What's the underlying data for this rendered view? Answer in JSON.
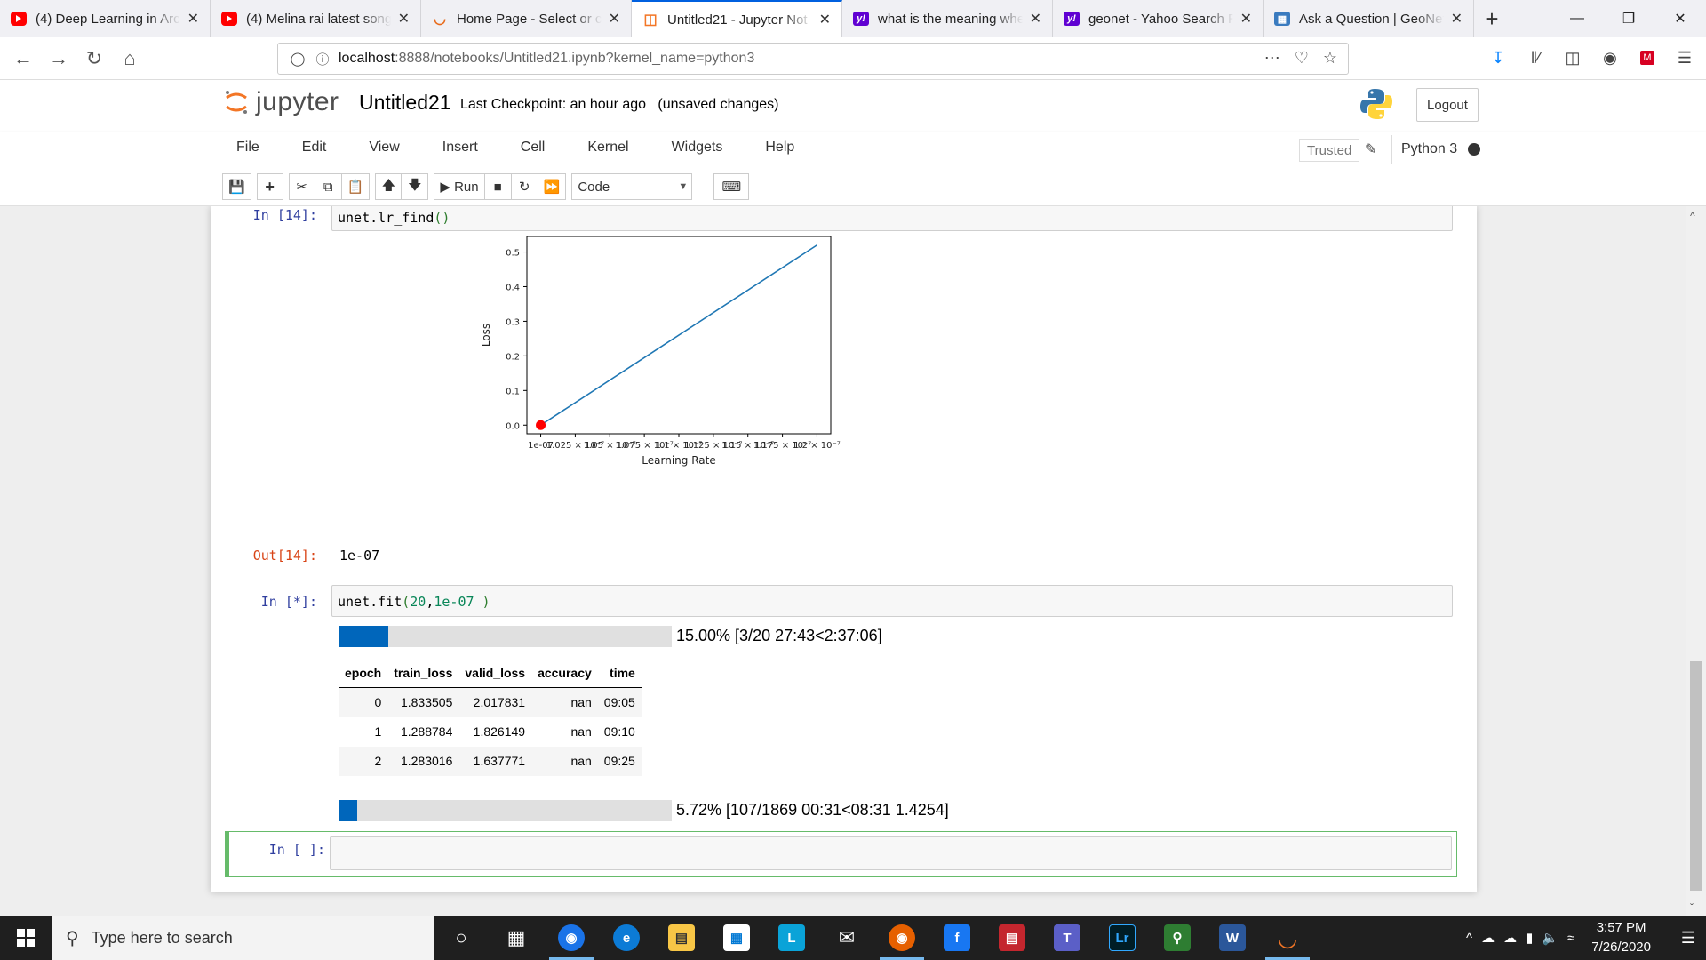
{
  "browser": {
    "tabs": [
      {
        "title": "(4) Deep Learning in Arc",
        "favicon": "youtube-icon",
        "active": false
      },
      {
        "title": "(4) Melina rai latest song",
        "favicon": "youtube-icon",
        "active": false
      },
      {
        "title": "Home Page - Select or c",
        "favicon": "upwork-icon",
        "active": false
      },
      {
        "title": "Untitled21 - Jupyter Not",
        "favicon": "jupyter-icon",
        "active": true
      },
      {
        "title": "what is the meaning whe",
        "favicon": "yahoo-icon",
        "active": false
      },
      {
        "title": "geonet - Yahoo Search R",
        "favicon": "yahoo-icon",
        "active": false
      },
      {
        "title": "Ask a Question | GeoNet",
        "favicon": "geonet-icon",
        "active": false
      }
    ],
    "url_host": "localhost",
    "url_path": ":8888/notebooks/Untitled21.ipynb?kernel_name=python3"
  },
  "jupyter": {
    "logo_text": "jupyter",
    "notebook_title": "Untitled21",
    "checkpoint": "Last Checkpoint: an hour ago",
    "unsaved": "(unsaved changes)",
    "logout": "Logout",
    "menu": [
      "File",
      "Edit",
      "View",
      "Insert",
      "Cell",
      "Kernel",
      "Widgets",
      "Help"
    ],
    "trusted": "Trusted",
    "kernel": "Python 3",
    "run_label": "Run",
    "cell_type": "Code"
  },
  "cells": {
    "c1_prompt": "In [14]:",
    "c1_obj": "unet",
    "c1_fn": ".lr_find",
    "c1_paren": "()",
    "out_prompt": "Out[14]:",
    "out_value": "1e-07",
    "c2_prompt": "In [*]:",
    "c2_obj": "unet",
    "c2_fn": ".fit",
    "c2_open": "(",
    "c2_arg1": "20",
    "c2_comma": ",",
    "c2_arg2": "1e-07",
    "c2_close": " )",
    "progress1": {
      "fraction": 0.15,
      "text": "15.00% [3/20 27:43<2:37:06]"
    },
    "progress2": {
      "fraction": 0.0572,
      "text": "5.72% [107/1869 00:31<08:31 1.4254]"
    },
    "table": {
      "headers": [
        "epoch",
        "train_loss",
        "valid_loss",
        "accuracy",
        "time"
      ],
      "rows": [
        [
          "0",
          "1.833505",
          "2.017831",
          "nan",
          "09:05"
        ],
        [
          "1",
          "1.288784",
          "1.826149",
          "nan",
          "09:10"
        ],
        [
          "2",
          "1.283016",
          "1.637771",
          "nan",
          "09:25"
        ]
      ]
    },
    "c3_prompt": "In [ ]:"
  },
  "chart_data": {
    "type": "line",
    "xlabel": "Learning Rate",
    "ylabel": "Loss",
    "x_tick_labels": [
      "1e-07",
      "1.025 × 10⁻⁷",
      "1.05 × 10⁻⁷",
      "1.075 × 10⁻⁷",
      "1.1 × 10⁻⁷",
      "1.125 × 10⁻⁷",
      "1.15 × 10⁻⁷",
      "1.175 × 10⁻⁷",
      "1.2 × 10⁻⁷"
    ],
    "x": [
      1e-07,
      1.2e-07
    ],
    "y": [
      0.0,
      0.52
    ],
    "xlim": [
      9.9e-08,
      1.21e-07
    ],
    "ylim": [
      -0.025,
      0.545
    ],
    "yticks": [
      0.0,
      0.1,
      0.2,
      0.3,
      0.4,
      0.5
    ],
    "marker": {
      "x": 1e-07,
      "y": 0.0,
      "color": "#ff0000"
    },
    "line_color": "#1f77b4"
  },
  "taskbar": {
    "search_placeholder": "Type here to search",
    "time": "3:57 PM",
    "date": "7/26/2020"
  }
}
